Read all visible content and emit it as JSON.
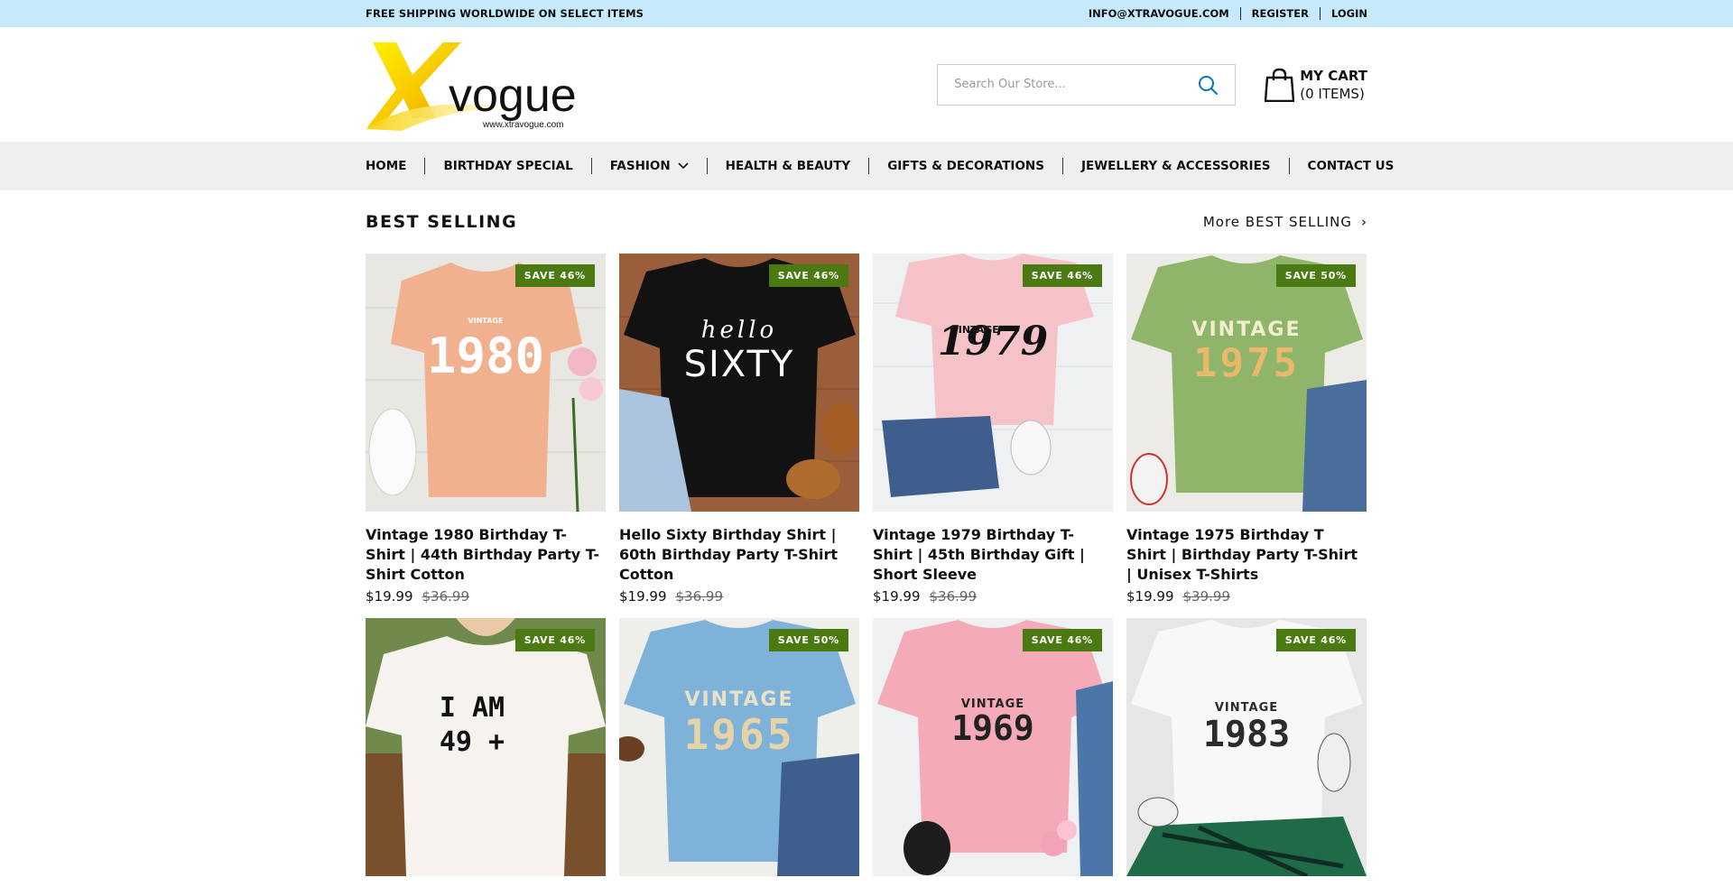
{
  "topbar": {
    "shipping": "FREE SHIPPING WORLDWIDE ON SELECT ITEMS",
    "email": "INFO@XTRAVOGUE.COM",
    "register": "REGISTER",
    "login": "LOGIN"
  },
  "logo": {
    "brand": "vogue",
    "url": "www.xtravogue.com"
  },
  "search": {
    "placeholder": "Search Our Store..."
  },
  "cart": {
    "label": "MY CART",
    "count": "(0 ITEMS)"
  },
  "nav": {
    "items": [
      {
        "label": "HOME"
      },
      {
        "label": "BIRTHDAY SPECIAL"
      },
      {
        "label": "FASHION"
      },
      {
        "label": "HEALTH & BEAUTY"
      },
      {
        "label": "GIFTS & DECORATIONS"
      },
      {
        "label": "JEWELLERY & ACCESSORIES"
      },
      {
        "label": "CONTACT US"
      }
    ]
  },
  "section": {
    "title": "BEST SELLING",
    "more": "More BEST SELLING"
  },
  "products": [
    {
      "badge": "SAVE 46%",
      "name": "Vintage 1980 Birthday T-Shirt | 44th Birthday Party T-Shirt Cotton",
      "price": "$19.99",
      "was": "$36.99",
      "print_top": "VINTAGE",
      "print_main": "1980"
    },
    {
      "badge": "SAVE 46%",
      "name": "Hello Sixty Birthday Shirt | 60th Birthday Party T-Shirt Cotton",
      "price": "$19.99",
      "was": "$36.99",
      "print_top": "hello",
      "print_main": "SIXTY"
    },
    {
      "badge": "SAVE 46%",
      "name": "Vintage 1979 Birthday T-Shirt | 45th Birthday Gift | Short Sleeve",
      "price": "$19.99",
      "was": "$36.99",
      "print_top": "VINTAGE",
      "print_main": "1979"
    },
    {
      "badge": "SAVE 50%",
      "name": "Vintage 1975 Birthday T Shirt | Birthday Party T-Shirt | Unisex T-Shirts",
      "price": "$19.99",
      "was": "$39.99",
      "print_top": "VINTAGE",
      "print_main": "1975"
    },
    {
      "badge": "SAVE 46%",
      "print_top": "I AM",
      "print_main": "49 +"
    },
    {
      "badge": "SAVE 50%",
      "print_top": "VINTAGE",
      "print_main": "1965"
    },
    {
      "badge": "SAVE 46%",
      "print_top": "VINTAGE",
      "print_main": "1969"
    },
    {
      "badge": "SAVE 46%",
      "print_top": "VINTAGE",
      "print_main": "1983"
    }
  ],
  "colors": {
    "topbar": "#c6e9fb",
    "nav": "#efefef",
    "badge": "#4b7a12",
    "logo_yellow": "#f4d000"
  }
}
